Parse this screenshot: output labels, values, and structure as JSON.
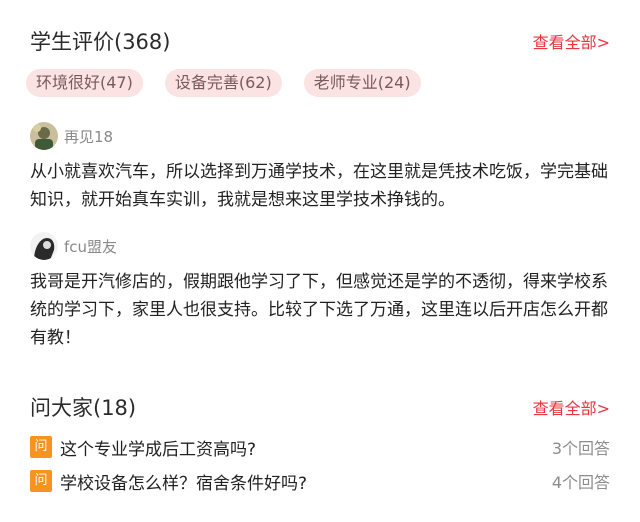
{
  "reviews_section": {
    "title": "学生评价(368)",
    "see_all": "查看全部>",
    "tags": [
      {
        "label": "环境很好(47)"
      },
      {
        "label": "设备完善(62)"
      },
      {
        "label": "老师专业(24)"
      }
    ],
    "items": [
      {
        "username": "再见18",
        "text": "从小就喜欢汽车，所以选择到万通学技术，在这里就是凭技术吃饭，学完基础知识，就开始真车实训，我就是想来这里学技术挣钱的。"
      },
      {
        "username": "fcu盟友",
        "text": "我哥是开汽修店的，假期跟他学习了下，但感觉还是学的不透彻，得来学校系统的学习下，家里人也很支持。比较了下选了万通，这里连以后开店怎么开都有教！"
      }
    ]
  },
  "questions_section": {
    "title": "问大家(18)",
    "see_all": "查看全部>",
    "badge": "问",
    "items": [
      {
        "text": "这个专业学成后工资高吗?",
        "count": "3个回答"
      },
      {
        "text": "学校设备怎么样？宿舍条件好吗?",
        "count": "4个回答"
      }
    ]
  },
  "colors": {
    "accent": "#e8363f",
    "tag_bg": "#fbe3e3",
    "badge_bg": "#f7931e"
  }
}
